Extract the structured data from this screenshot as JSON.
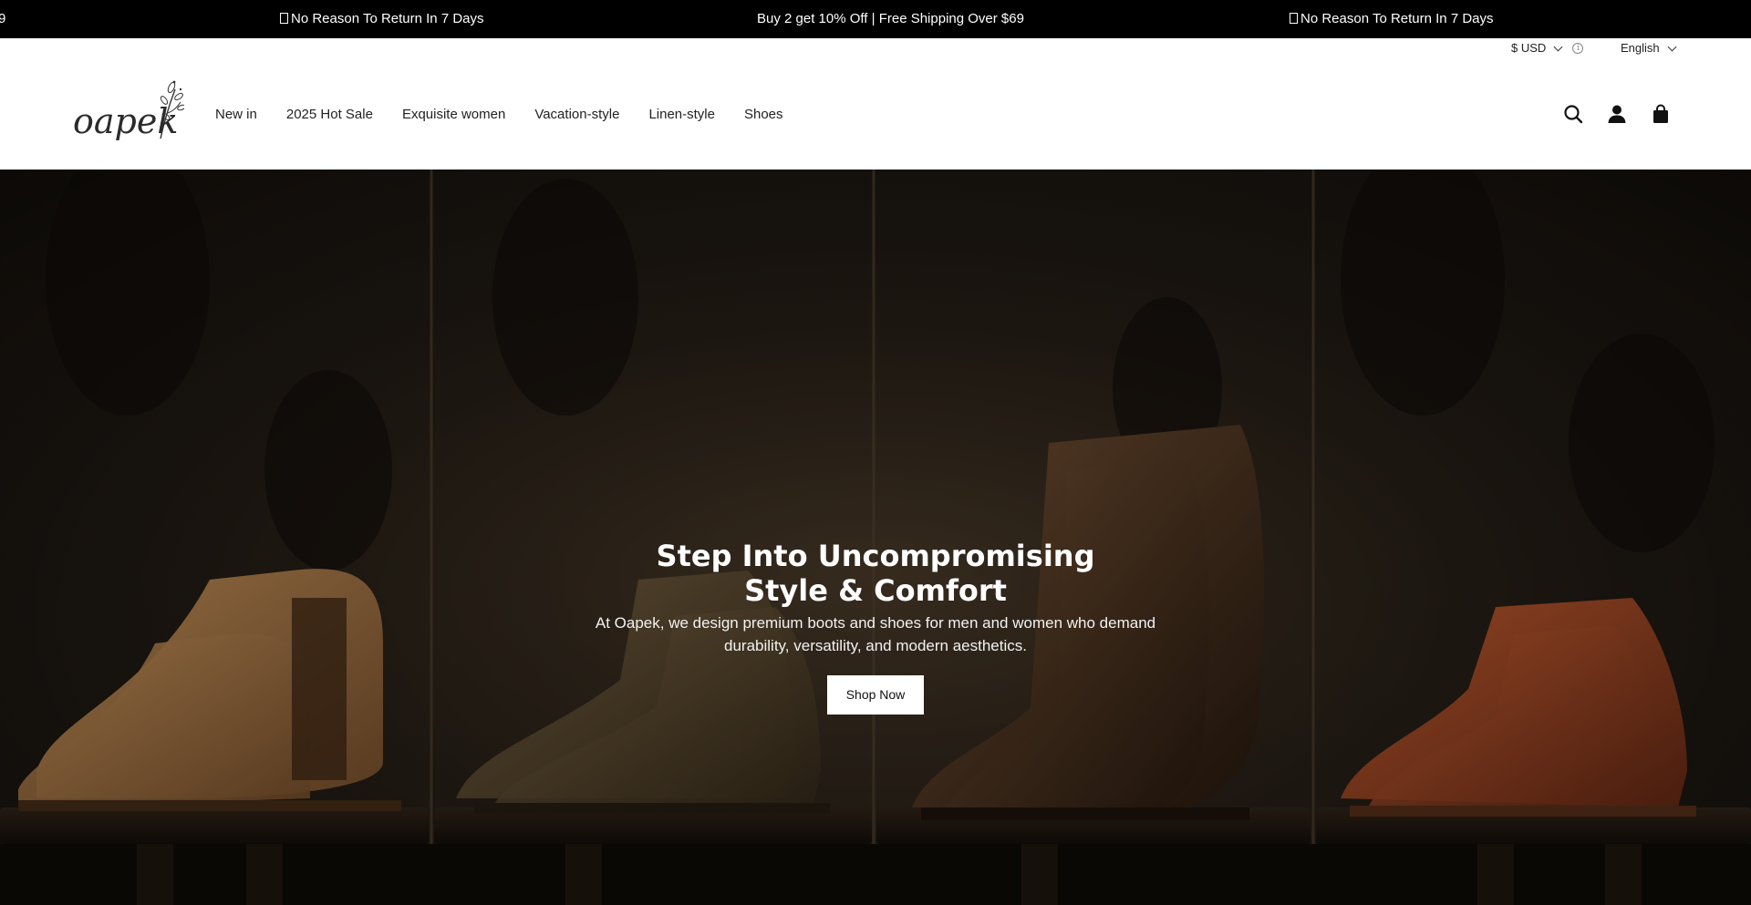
{
  "announcement": {
    "items": [
      {
        "text": "9",
        "glyph": false
      },
      {
        "text": "No Reason To Return In 7 Days",
        "glyph": true
      },
      {
        "text": "Buy 2 get 10% Off | Free Shipping Over $69",
        "glyph": false
      },
      {
        "text": "No Reason To Return In 7 Days",
        "glyph": true
      }
    ],
    "background": "#000000"
  },
  "utility": {
    "currency": "$ USD",
    "language": "English"
  },
  "header": {
    "logo_text": "oapek",
    "nav": [
      "New in",
      "2025 Hot Sale",
      "Exquisite women",
      "Vacation-style",
      "Linen-style",
      "Shoes"
    ],
    "icons": [
      "search-icon",
      "account-icon",
      "cart-icon"
    ]
  },
  "hero": {
    "title": "Step Into Uncompromising Style & Comfort",
    "subtitle": "At Oapek, we design premium boots and shoes for men and women who demand durability, versatility, and modern aesthetics.",
    "cta_label": "Shop Now"
  },
  "colors": {
    "text": "#222222",
    "hero_bg": "#201a14",
    "button_bg": "#ffffff"
  }
}
